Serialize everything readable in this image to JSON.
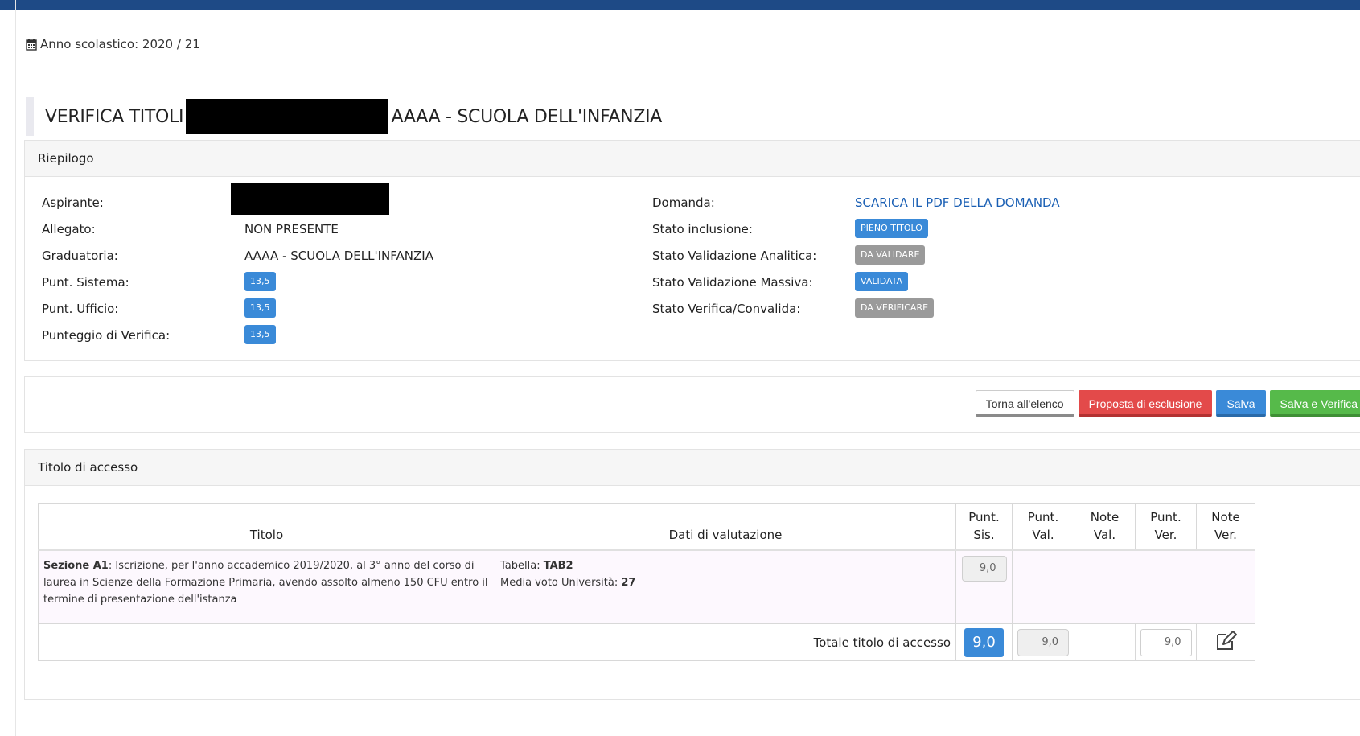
{
  "header": {
    "year_label": "Anno scolastico: 2020 / 21",
    "title_prefix": "VERIFICA TITOLI -",
    "title_suffix": "AAAA - SCUOLA DELL'INFANZIA"
  },
  "summary": {
    "heading": "Riepilogo",
    "left": [
      {
        "label": "Aspirante:",
        "value": ""
      },
      {
        "label": "Allegato:",
        "value": "NON PRESENTE"
      },
      {
        "label": "Graduatoria:",
        "value": "AAAA - SCUOLA DELL'INFANZIA"
      },
      {
        "label": "Punt. Sistema:",
        "value": "13,5"
      },
      {
        "label": "Punt. Ufficio:",
        "value": "13,5"
      },
      {
        "label": "Punteggio di Verifica:",
        "value": "13,5"
      }
    ],
    "right": [
      {
        "label": "Domanda:",
        "value": "SCARICA IL PDF DELLA DOMANDA"
      },
      {
        "label": "Stato inclusione:",
        "value": "PIENO TITOLO",
        "color": "#3a8ad8"
      },
      {
        "label": "Stato Validazione Analitica:",
        "value": "DA VALIDARE",
        "color": "#9a9a9a"
      },
      {
        "label": "Stato Validazione Massiva:",
        "value": "VALIDATA",
        "color": "#3a8ad8"
      },
      {
        "label": "Stato Verifica/Convalida:",
        "value": "DA VERIFICARE",
        "color": "#9a9a9a"
      }
    ]
  },
  "actions": {
    "back": "Torna all'elenco",
    "exclude": "Proposta di esclusione",
    "save": "Salva",
    "save_verify": "Salva e Verifica"
  },
  "access": {
    "heading": "Titolo di accesso",
    "columns": {
      "titolo": "Titolo",
      "dati": "Dati di valutazione",
      "punt_sis_1": "Punt.",
      "punt_sis_2": "Sis.",
      "punt_val_1": "Punt.",
      "punt_val_2": "Val.",
      "note_val_1": "Note",
      "note_val_2": "Val.",
      "punt_ver_1": "Punt.",
      "punt_ver_2": "Ver.",
      "note_ver_1": "Note",
      "note_ver_2": "Ver."
    },
    "row": {
      "section_label": "Sezione A1",
      "section_text": ": Iscrizione, per l'anno accademico 2019/2020, al 3° anno del corso di laurea in Scienze della Formazione Primaria, avendo assolto almeno 150 CFU entro il termine di presentazione dell'istanza",
      "tabella_label": "Tabella: ",
      "tabella_value": "TAB2",
      "media_label": "Media voto Università: ",
      "media_value": "27",
      "punt_sis": "9,0"
    },
    "total": {
      "label": "Totale titolo di accesso",
      "sis": "9,0",
      "val": "9,0",
      "ver": "9,0"
    }
  },
  "colors": {
    "primary": "#3a8ad8",
    "danger": "#e34a4a",
    "success": "#56ba4a",
    "topbar": "#1e4a86"
  }
}
